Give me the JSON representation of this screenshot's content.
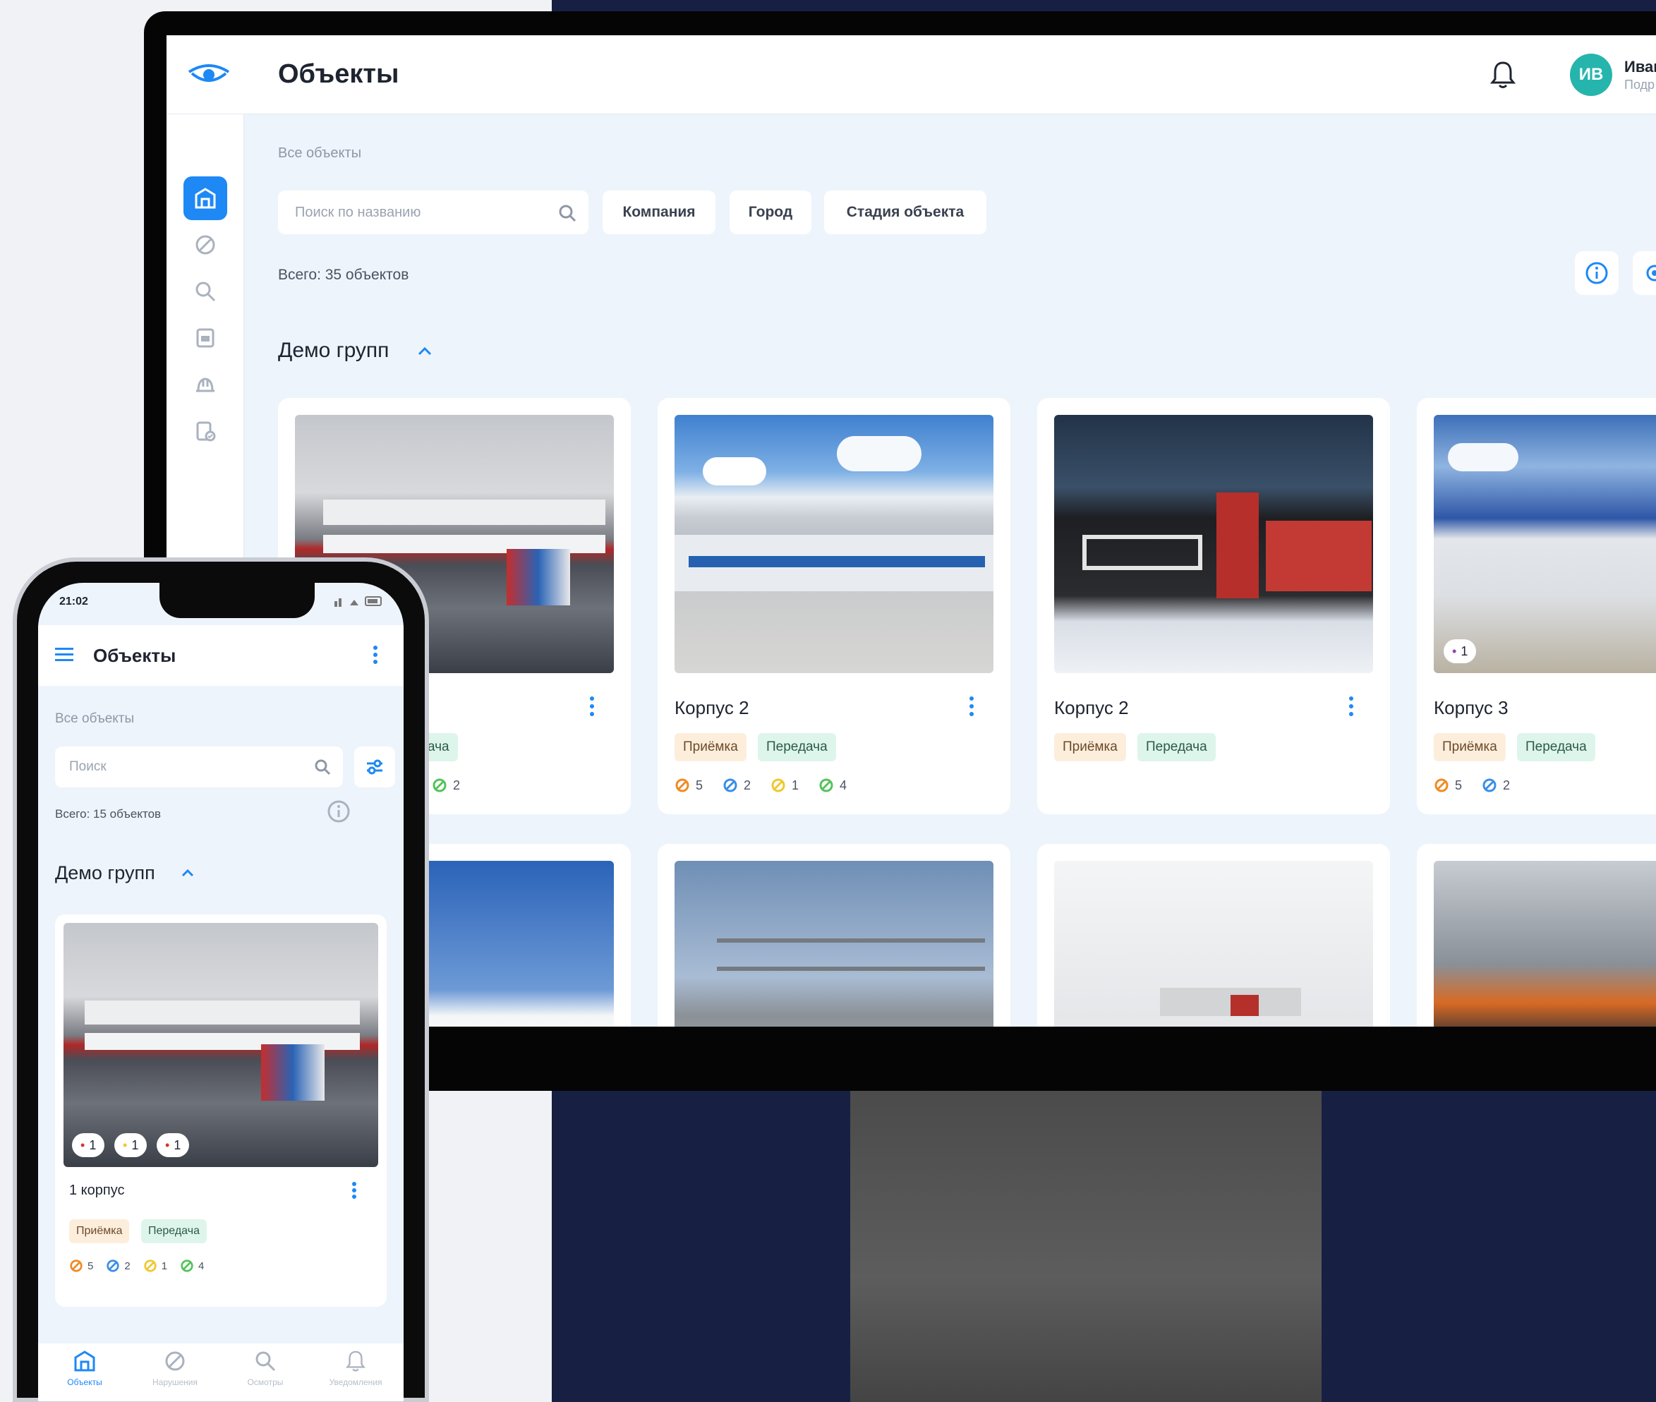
{
  "desktop": {
    "title": "Объекты",
    "user": {
      "initials": "ИВ",
      "name": "Иван",
      "role": "Подр"
    },
    "breadcrumb": "Все объекты",
    "search_placeholder": "Поиск по названию",
    "filters": [
      "Компания",
      "Город",
      "Стадия объекта"
    ],
    "total": "Всего: 35 объектов",
    "group": "Демо групп",
    "cards": [
      {
        "title": "",
        "tags": [
          "ача"
        ],
        "stats": [
          {
            "color": "#55c25a",
            "value": "2"
          }
        ]
      },
      {
        "title": "Корпус 2",
        "tags": [
          "Приёмка",
          "Передача"
        ],
        "stats": [
          {
            "color": "#f08a24",
            "value": "5"
          },
          {
            "color": "#3a8ee6",
            "value": "2"
          },
          {
            "color": "#f2c72e",
            "value": "1"
          },
          {
            "color": "#55c25a",
            "value": "4"
          }
        ]
      },
      {
        "title": "Корпус 2",
        "tags": [
          "Приёмка",
          "Передача"
        ],
        "stats": []
      },
      {
        "title": "Корпус 3",
        "tags": [
          "Приёмка",
          "Передача"
        ],
        "stats": [
          {
            "color": "#f08a24",
            "value": "5"
          },
          {
            "color": "#3a8ee6",
            "value": "2"
          }
        ],
        "badge": "1"
      }
    ]
  },
  "phone": {
    "time": "21:02",
    "title": "Объекты",
    "breadcrumb": "Все объекты",
    "search_placeholder": "Поиск",
    "total": "Всего: 15 объектов",
    "group": "Демо групп",
    "card": {
      "title": "1 корпус",
      "tags": [
        "Приёмка",
        "Передача"
      ],
      "badges": [
        "1",
        "1",
        "1"
      ],
      "stats": [
        {
          "color": "#f08a24",
          "value": "5"
        },
        {
          "color": "#3a8ee6",
          "value": "2"
        },
        {
          "color": "#f2c72e",
          "value": "1"
        },
        {
          "color": "#55c25a",
          "value": "4"
        }
      ]
    },
    "tabs": [
      "Объекты",
      "Нарушения",
      "Осмотры",
      "Уведомления"
    ]
  }
}
